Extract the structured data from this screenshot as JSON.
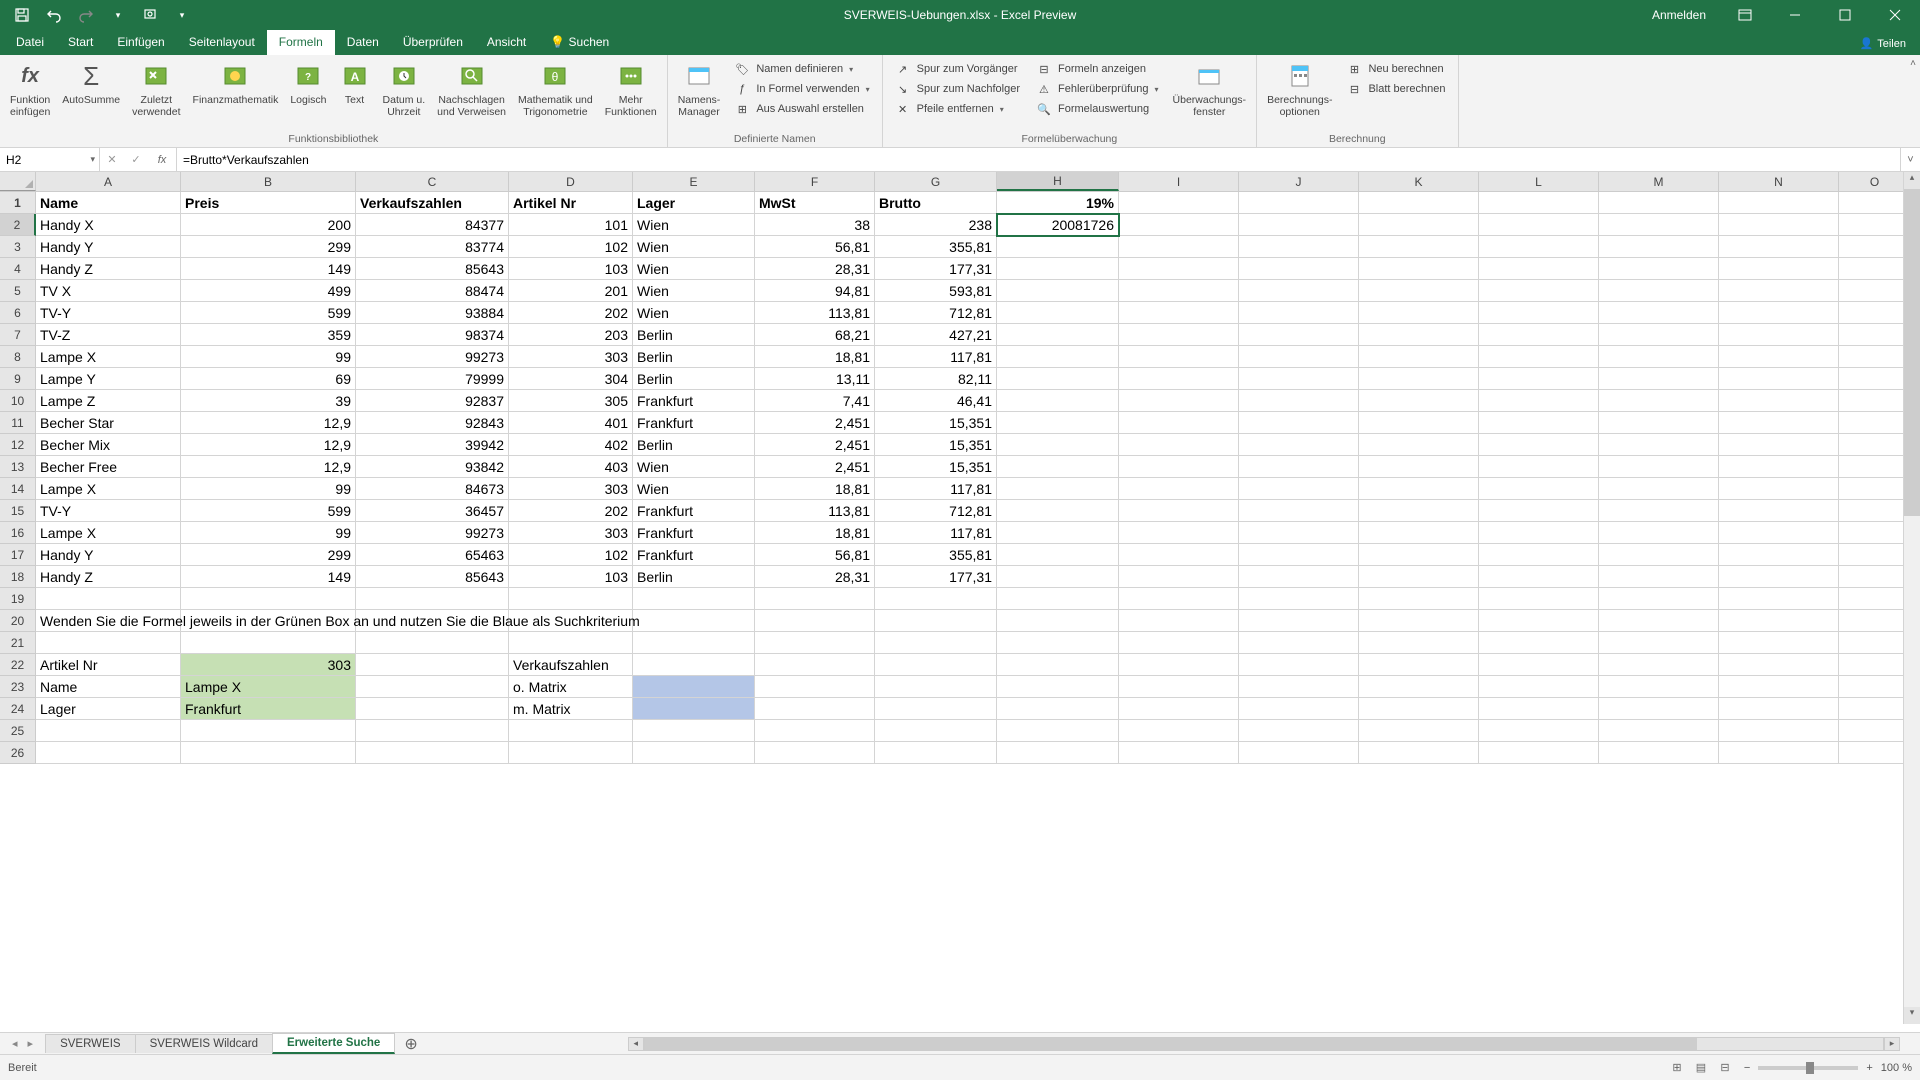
{
  "titlebar": {
    "title": "SVERWEIS-Uebungen.xlsx - Excel Preview",
    "signin": "Anmelden"
  },
  "tabs": {
    "datei": "Datei",
    "start": "Start",
    "einfuegen": "Einfügen",
    "seitenlayout": "Seitenlayout",
    "formeln": "Formeln",
    "daten": "Daten",
    "ueberpruefen": "Überprüfen",
    "ansicht": "Ansicht",
    "suchen": "Suchen",
    "teilen": "Teilen"
  },
  "ribbon": {
    "g1": {
      "label": "Funktionsbibliothek",
      "fx": "Funktion\neinfügen",
      "sum": "AutoSumme",
      "recent": "Zuletzt\nverwendet",
      "fin": "Finanzmathematik",
      "log": "Logisch",
      "text": "Text",
      "date": "Datum u.\nUhrzeit",
      "lookup": "Nachschlagen\nund Verweisen",
      "math": "Mathematik und\nTrigonometrie",
      "more": "Mehr\nFunktionen"
    },
    "g2": {
      "label": "Definierte Namen",
      "mgr": "Namens-\nManager",
      "def": "Namen definieren",
      "use": "In Formel verwenden",
      "sel": "Aus Auswahl erstellen"
    },
    "g3": {
      "label": "Formelüberwachung",
      "pre": "Spur zum Vorgänger",
      "dep": "Spur zum Nachfolger",
      "rem": "Pfeile entfernen",
      "show": "Formeln anzeigen",
      "err": "Fehlerüberprüfung",
      "eval": "Formelauswertung",
      "watch": "Überwachungs-\nfenster"
    },
    "g4": {
      "label": "Berechnung",
      "opts": "Berechnungs-\noptionen",
      "now": "Neu berechnen",
      "sheet": "Blatt berechnen"
    }
  },
  "namebox": "H2",
  "formula": "=Brutto*Verkaufszahlen",
  "columns": [
    "A",
    "B",
    "C",
    "D",
    "E",
    "F",
    "G",
    "H",
    "I",
    "J",
    "K",
    "L",
    "M",
    "N",
    "O"
  ],
  "headers": {
    "A": "Name",
    "B": "Preis",
    "C": "Verkaufszahlen",
    "D": "Artikel Nr",
    "E": "Lager",
    "F": "MwSt",
    "G": "Brutto",
    "H": "19%"
  },
  "rows": [
    {
      "n": 2,
      "A": "Handy X",
      "B": "200",
      "C": "84377",
      "D": "101",
      "E": "Wien",
      "F": "38",
      "G": "238",
      "H": "20081726",
      "active": true
    },
    {
      "n": 3,
      "A": "Handy Y",
      "B": "299",
      "C": "83774",
      "D": "102",
      "E": "Wien",
      "F": "56,81",
      "G": "355,81"
    },
    {
      "n": 4,
      "A": "Handy Z",
      "B": "149",
      "C": "85643",
      "D": "103",
      "E": "Wien",
      "F": "28,31",
      "G": "177,31",
      "cursor": true
    },
    {
      "n": 5,
      "A": "TV X",
      "B": "499",
      "C": "88474",
      "D": "201",
      "E": "Wien",
      "F": "94,81",
      "G": "593,81"
    },
    {
      "n": 6,
      "A": "TV-Y",
      "B": "599",
      "C": "93884",
      "D": "202",
      "E": "Wien",
      "F": "113,81",
      "G": "712,81"
    },
    {
      "n": 7,
      "A": "TV-Z",
      "B": "359",
      "C": "98374",
      "D": "203",
      "E": "Berlin",
      "F": "68,21",
      "G": "427,21"
    },
    {
      "n": 8,
      "A": "Lampe X",
      "B": "99",
      "C": "99273",
      "D": "303",
      "E": "Berlin",
      "F": "18,81",
      "G": "117,81"
    },
    {
      "n": 9,
      "A": "Lampe Y",
      "B": "69",
      "C": "79999",
      "D": "304",
      "E": "Berlin",
      "F": "13,11",
      "G": "82,11"
    },
    {
      "n": 10,
      "A": "Lampe Z",
      "B": "39",
      "C": "92837",
      "D": "305",
      "E": "Frankfurt",
      "F": "7,41",
      "G": "46,41"
    },
    {
      "n": 11,
      "A": "Becher Star",
      "B": "12,9",
      "C": "92843",
      "D": "401",
      "E": "Frankfurt",
      "F": "2,451",
      "G": "15,351"
    },
    {
      "n": 12,
      "A": "Becher Mix",
      "B": "12,9",
      "C": "39942",
      "D": "402",
      "E": "Berlin",
      "F": "2,451",
      "G": "15,351"
    },
    {
      "n": 13,
      "A": "Becher Free",
      "B": "12,9",
      "C": "93842",
      "D": "403",
      "E": "Wien",
      "F": "2,451",
      "G": "15,351"
    },
    {
      "n": 14,
      "A": "Lampe X",
      "B": "99",
      "C": "84673",
      "D": "303",
      "E": "Wien",
      "F": "18,81",
      "G": "117,81"
    },
    {
      "n": 15,
      "A": "TV-Y",
      "B": "599",
      "C": "36457",
      "D": "202",
      "E": "Frankfurt",
      "F": "113,81",
      "G": "712,81"
    },
    {
      "n": 16,
      "A": "Lampe X",
      "B": "99",
      "C": "99273",
      "D": "303",
      "E": "Frankfurt",
      "F": "18,81",
      "G": "117,81"
    },
    {
      "n": 17,
      "A": "Handy Y",
      "B": "299",
      "C": "65463",
      "D": "102",
      "E": "Frankfurt",
      "F": "56,81",
      "G": "355,81"
    },
    {
      "n": 18,
      "A": "Handy Z",
      "B": "149",
      "C": "85643",
      "D": "103",
      "E": "Berlin",
      "F": "28,31",
      "G": "177,31"
    }
  ],
  "instruction_row": {
    "n": 20,
    "text": "Wenden Sie die Formel jeweils in der Grünen Box an und nutzen Sie die Blaue als Suchkriterium"
  },
  "lookup": {
    "r22": {
      "A": "Artikel Nr",
      "B": "303",
      "D": "Verkaufszahlen"
    },
    "r23": {
      "A": "Name",
      "B": "Lampe X",
      "D": "o. Matrix"
    },
    "r24": {
      "A": "Lager",
      "B": "Frankfurt",
      "D": "m. Matrix"
    }
  },
  "sheets": {
    "s1": "SVERWEIS",
    "s2": "SVERWEIS Wildcard",
    "s3": "Erweiterte Suche"
  },
  "status": {
    "ready": "Bereit",
    "zoom": "100 %"
  },
  "colors": {
    "green": "#217346",
    "cell_green": "#c6e0b4",
    "cell_blue": "#b4c6e7"
  }
}
